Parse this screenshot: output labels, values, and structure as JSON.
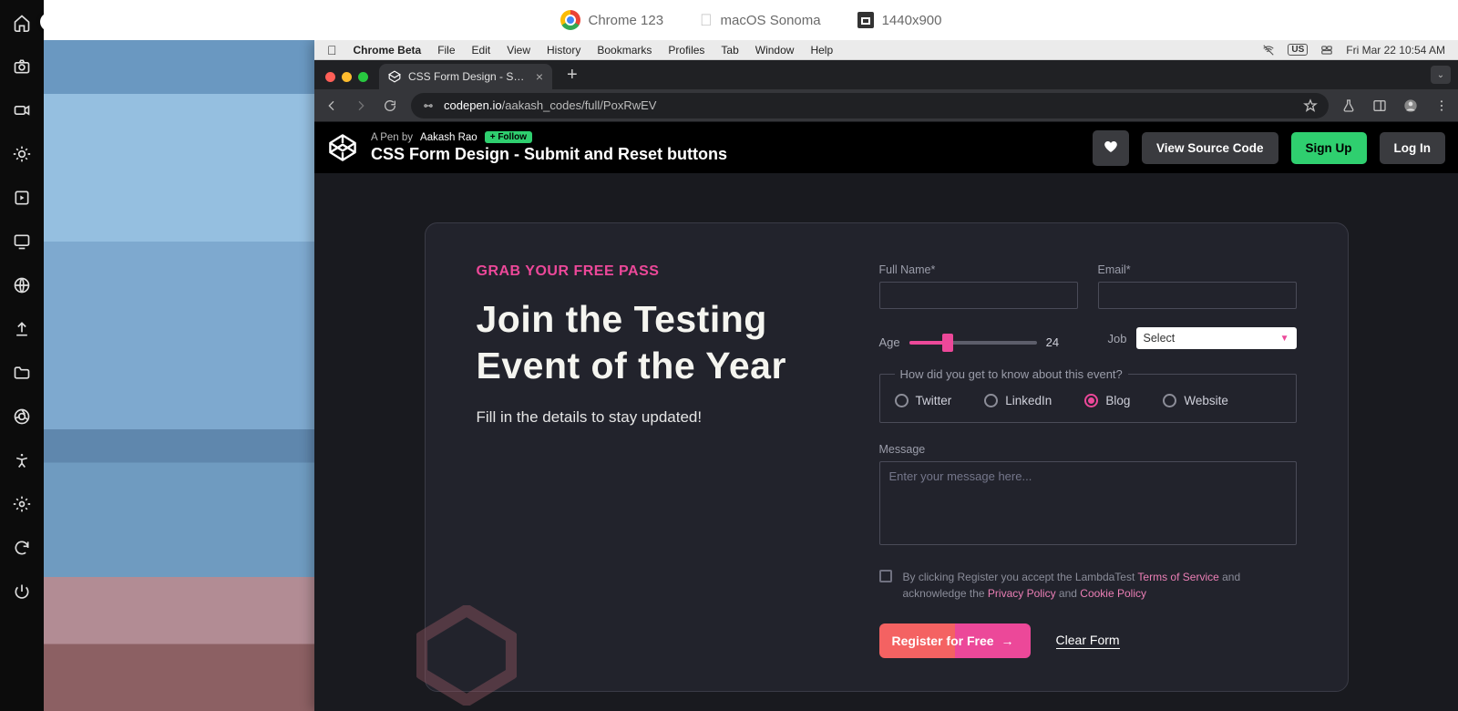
{
  "metabar": {
    "chrome": "Chrome 123",
    "os": "macOS Sonoma",
    "resolution": "1440x900"
  },
  "mac_menu": {
    "app": "Chrome Beta",
    "items": [
      "File",
      "Edit",
      "View",
      "History",
      "Bookmarks",
      "Profiles",
      "Tab",
      "Window",
      "Help"
    ],
    "lang": "US",
    "clock": "Fri Mar 22  10:54 AM"
  },
  "browser": {
    "tab_title": "CSS Form Design - Submit a",
    "url_host": "codepen.io",
    "url_path": "/aakash_codes/full/PoxRwEV"
  },
  "pen_header": {
    "byline_prefix": "A Pen by",
    "author": "Aakash Rao",
    "follow": "+ Follow",
    "title": "CSS Form Design - Submit and Reset buttons",
    "view_source": "View Source Code",
    "signup": "Sign Up",
    "login": "Log In"
  },
  "form": {
    "eyebrow": "GRAB YOUR FREE PASS",
    "heading": "Join the Testing Event of the Year",
    "sub": "Fill in the details to stay updated!",
    "fullname_label": "Full Name*",
    "email_label": "Email*",
    "age_label": "Age",
    "age_value": "24",
    "job_label": "Job",
    "job_select": "Select",
    "radio_legend": "How did you get to know about this event?",
    "radios": [
      "Twitter",
      "LinkedIn",
      "Blog",
      "Website"
    ],
    "radio_selected": "Blog",
    "message_label": "Message",
    "message_placeholder": "Enter your message here...",
    "terms_pre": "By clicking Register you accept the LambdaTest ",
    "terms_tos": "Terms of Service",
    "terms_mid1": " and acknowledge the ",
    "terms_privacy": "Privacy Policy",
    "terms_mid2": " and ",
    "terms_cookie": "Cookie Policy",
    "register": "Register for Free",
    "clear": "Clear Form"
  }
}
